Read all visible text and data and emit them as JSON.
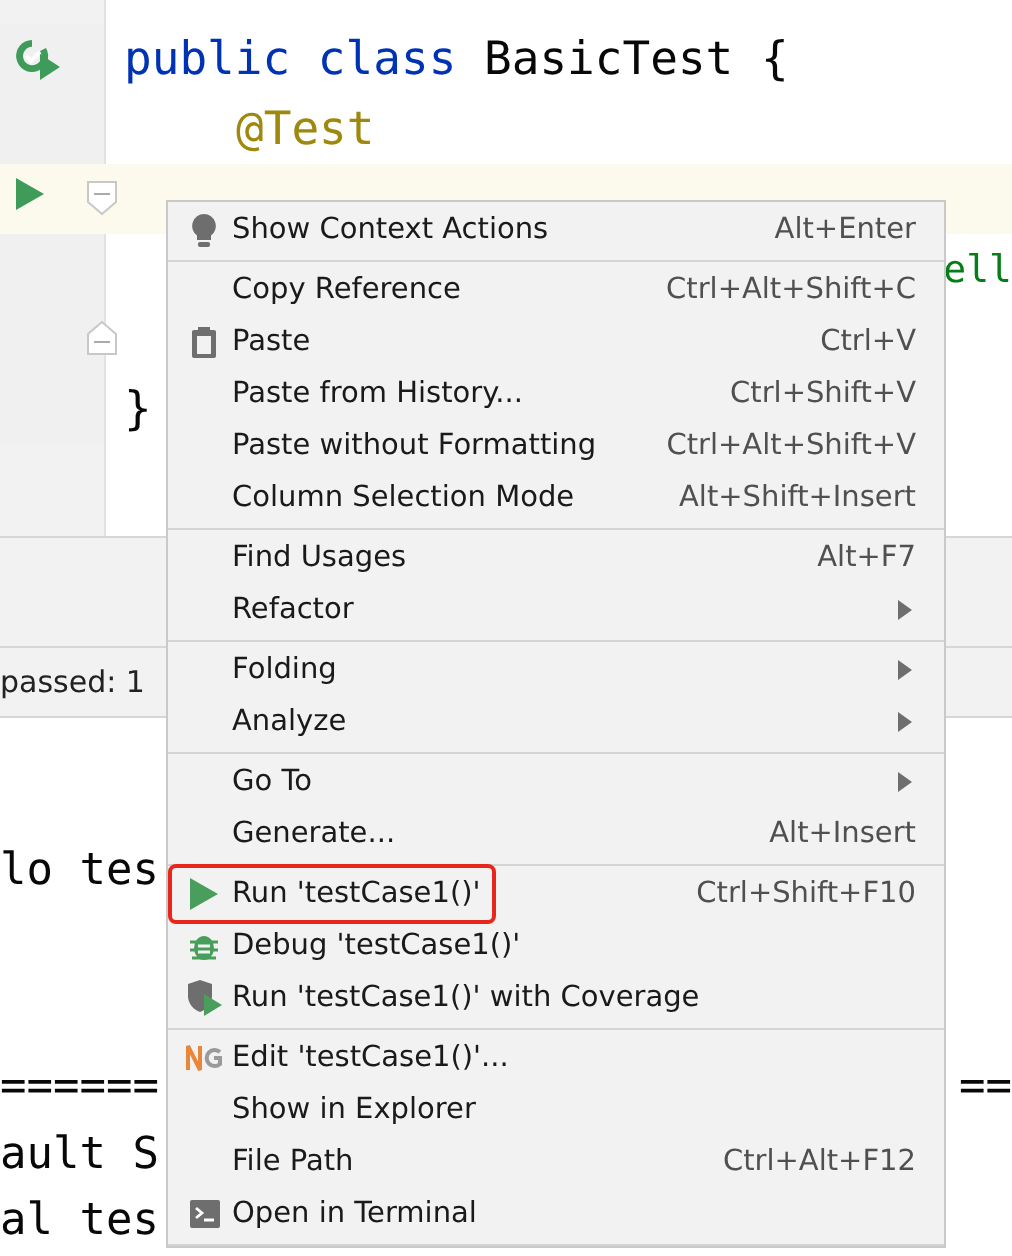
{
  "editor": {
    "code_lines": [
      {
        "parts": [
          {
            "text": "public class ",
            "kind": "keyword"
          },
          {
            "text": "BasicTest {",
            "kind": "plain"
          }
        ],
        "kind": "run-class",
        "current": false
      },
      {
        "parts": [
          {
            "text": "@Test",
            "kind": "annotation"
          }
        ],
        "kind": "plain",
        "current": false
      },
      {
        "kind": "run",
        "current": true
      },
      {
        "right_fragment": "ell",
        "kind": "plain",
        "current": false
      },
      {
        "kind": "fold",
        "current": false
      },
      {
        "parts": [
          {
            "text": "}",
            "kind": "plain"
          }
        ],
        "kind": "plain",
        "current": false
      }
    ]
  },
  "status_bar": {
    "label": "passed: 1"
  },
  "console": {
    "lines": [
      {
        "left": "lo tes"
      },
      {
        "left": "======",
        "right": "=="
      },
      {
        "left": "ault S"
      },
      {
        "left": "al tes"
      }
    ]
  },
  "context_menu": {
    "groups": [
      [
        {
          "label": "Show Context Actions",
          "shortcut": "Alt+Enter",
          "kind": "bulb",
          "submenu": false,
          "highlighted": false
        }
      ],
      [
        {
          "label": "Copy Reference",
          "shortcut": "Ctrl+Alt+Shift+C",
          "kind": "plain",
          "submenu": false,
          "highlighted": false
        },
        {
          "label": "Paste",
          "shortcut": "Ctrl+V",
          "kind": "clipboard",
          "submenu": false,
          "highlighted": false
        },
        {
          "label": "Paste from History...",
          "shortcut": "Ctrl+Shift+V",
          "kind": "plain",
          "submenu": false,
          "highlighted": false
        },
        {
          "label": "Paste without Formatting",
          "shortcut": "Ctrl+Alt+Shift+V",
          "kind": "plain",
          "submenu": false,
          "highlighted": false
        },
        {
          "label": "Column Selection Mode",
          "shortcut": "Alt+Shift+Insert",
          "kind": "plain",
          "submenu": false,
          "highlighted": false
        }
      ],
      [
        {
          "label": "Find Usages",
          "shortcut": "Alt+F7",
          "kind": "plain",
          "submenu": false,
          "highlighted": false
        },
        {
          "label": "Refactor",
          "kind": "plain",
          "submenu": true,
          "highlighted": false
        }
      ],
      [
        {
          "label": "Folding",
          "kind": "plain",
          "submenu": true,
          "highlighted": false
        },
        {
          "label": "Analyze",
          "kind": "plain",
          "submenu": true,
          "highlighted": false
        }
      ],
      [
        {
          "label": "Go To",
          "kind": "plain",
          "submenu": true,
          "highlighted": false
        },
        {
          "label": "Generate...",
          "shortcut": "Alt+Insert",
          "kind": "plain",
          "submenu": false,
          "highlighted": false
        }
      ],
      [
        {
          "label": "Run 'testCase1()'",
          "shortcut": "Ctrl+Shift+F10",
          "kind": "run",
          "submenu": false,
          "highlighted": true
        },
        {
          "label": "Debug 'testCase1()'",
          "kind": "debug",
          "submenu": false,
          "highlighted": false
        },
        {
          "label": "Run 'testCase1()' with Coverage",
          "kind": "coverage",
          "submenu": false,
          "highlighted": false
        }
      ],
      [
        {
          "label": "Edit 'testCase1()'...",
          "kind": "testng",
          "submenu": false,
          "highlighted": false
        },
        {
          "label": "Show in Explorer",
          "kind": "plain",
          "submenu": false,
          "highlighted": false
        },
        {
          "label": "File Path",
          "shortcut": "Ctrl+Alt+F12",
          "kind": "plain",
          "submenu": false,
          "highlighted": false
        },
        {
          "label": "Open in Terminal",
          "kind": "terminal",
          "submenu": false,
          "highlighted": false
        }
      ]
    ]
  }
}
